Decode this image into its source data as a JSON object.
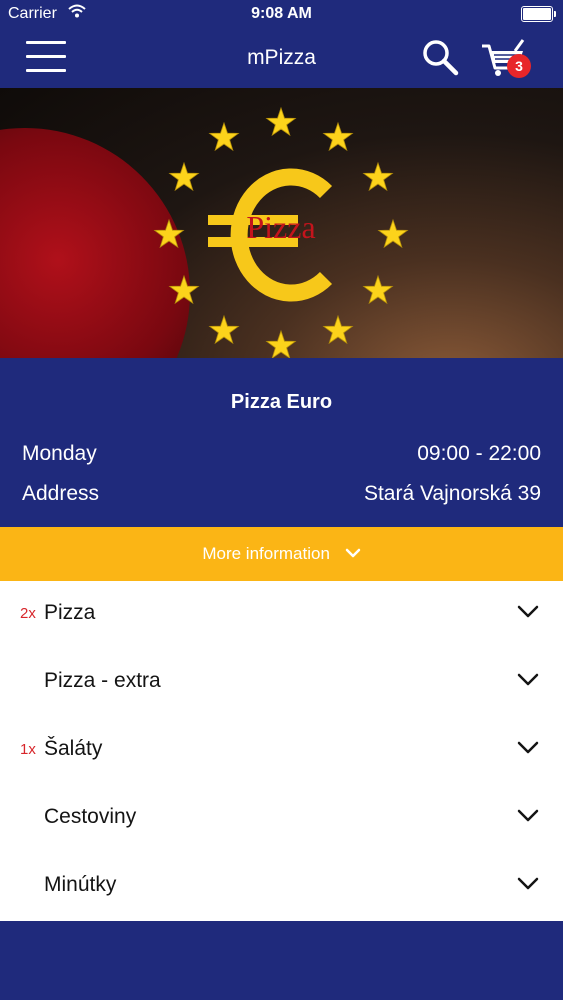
{
  "status_bar": {
    "carrier": "Carrier",
    "time": "9:08 AM"
  },
  "nav": {
    "title": "mPizza",
    "cart_count": "3"
  },
  "hero": {
    "logo_text": "Pizza"
  },
  "restaurant": {
    "name": "Pizza Euro",
    "hours_label": "Monday",
    "hours_value": "09:00 - 22:00",
    "address_label": "Address",
    "address_value": "Stará Vajnorská 39"
  },
  "more_info_label": "More information",
  "categories": [
    {
      "qty": "2x",
      "label": "Pizza"
    },
    {
      "qty": "",
      "label": "Pizza - extra"
    },
    {
      "qty": "1x",
      "label": "Šaláty"
    },
    {
      "qty": "",
      "label": "Cestoviny"
    },
    {
      "qty": "",
      "label": "Minútky"
    }
  ],
  "colors": {
    "primary": "#1f2a7c",
    "accent": "#fbb515",
    "badge": "#e8262a",
    "quantity": "#d7262b"
  }
}
